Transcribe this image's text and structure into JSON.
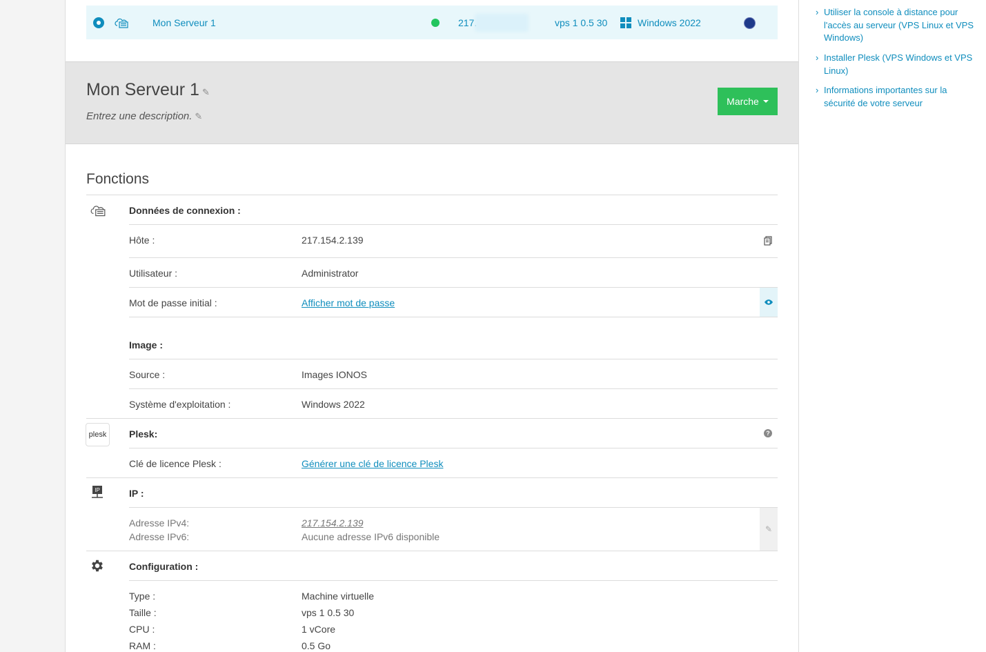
{
  "server_row": {
    "name": "Mon Serveur 1",
    "ip_prefix": "217.",
    "plan": "vps 1 0.5 30",
    "os": "Windows 2022"
  },
  "header": {
    "title": "Mon Serveur 1",
    "description_placeholder": "Entrez une description.",
    "power_button": "Marche"
  },
  "section_title": "Fonctions",
  "connection": {
    "heading": "Données de connexion :",
    "host_label": "Hôte :",
    "host_value": "217.154.2.139",
    "user_label": "Utilisateur :",
    "user_value": "Administrator",
    "password_label": "Mot de passe initial :",
    "password_link": "Afficher mot de passe"
  },
  "image": {
    "heading": "Image :",
    "source_label": "Source :",
    "source_value": "Images IONOS",
    "os_label": "Système d'exploitation :",
    "os_value": "Windows 2022"
  },
  "plesk": {
    "logo_text": "plesk",
    "heading": "Plesk:",
    "license_label": "Clé de licence Plesk :",
    "license_link": "Générer une clé de licence Plesk"
  },
  "ip": {
    "icon_text": "IP",
    "heading": "IP :",
    "ipv4_label": "Adresse IPv4:",
    "ipv4_value": "217.154.2.139",
    "ipv6_label": "Adresse IPv6:",
    "ipv6_value": "Aucune adresse IPv6 disponible"
  },
  "config": {
    "heading": "Configuration :",
    "type_label": "Type :",
    "type_value": "Machine virtuelle",
    "size_label": "Taille :",
    "size_value": "vps 1 0.5 30",
    "cpu_label": "CPU :",
    "cpu_value": "1 vCore",
    "ram_label": "RAM :",
    "ram_value": "0.5 Go"
  },
  "sidebar": {
    "links": [
      "Utiliser la console à distance pour l'accès au serveur (VPS Linux et VPS Windows)",
      "Installer Plesk (VPS Windows et VPS Linux)",
      "Informations importantes sur la sécurité de votre serveur"
    ]
  },
  "colors": {
    "accent": "#0f8dbd",
    "success": "#2ec05a",
    "row_highlight": "#e8f7fb"
  }
}
